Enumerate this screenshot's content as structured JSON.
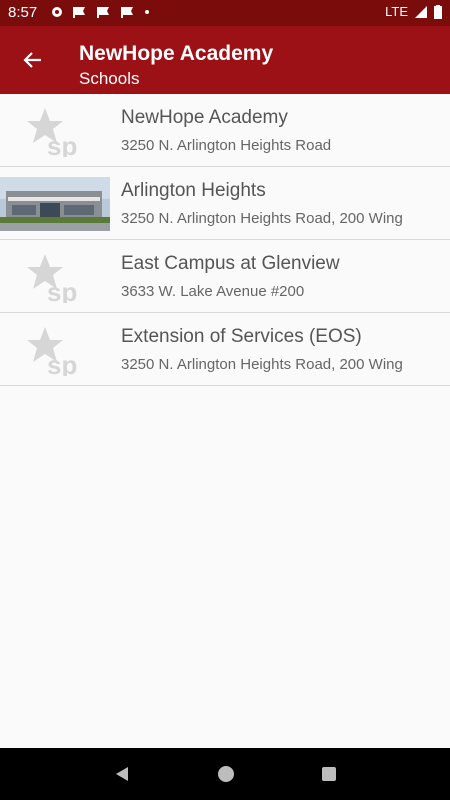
{
  "status_bar": {
    "time": "8:57",
    "network": "LTE",
    "icons": [
      "gear-icon",
      "flag-icon",
      "flag-icon",
      "flag-icon",
      "dot-icon"
    ]
  },
  "app_bar": {
    "title": "NewHope Academy",
    "subtitle": "Schools",
    "back_icon": "arrow-left-icon"
  },
  "schools": [
    {
      "name": "NewHope Academy",
      "address": "3250 N. Arlington Heights Road",
      "thumbnail": "sp-logo-placeholder"
    },
    {
      "name": "Arlington Heights",
      "address": "3250 N. Arlington Heights Road, 200 Wing",
      "thumbnail": "building-photo"
    },
    {
      "name": "East Campus at Glenview",
      "address": "3633 W. Lake Avenue #200",
      "thumbnail": "sp-logo-placeholder"
    },
    {
      "name": "Extension of Services (EOS)",
      "address": "3250 N. Arlington Heights Road, 200 Wing",
      "thumbnail": "sp-logo-placeholder"
    }
  ],
  "nav_bar": {
    "back": "back-triangle-icon",
    "home": "home-circle-icon",
    "recents": "recents-square-icon"
  },
  "colors": {
    "app_bar": "#9c1116",
    "status_bar": "#7a0c0c",
    "placeholder_logo": "#d6d6d6"
  }
}
